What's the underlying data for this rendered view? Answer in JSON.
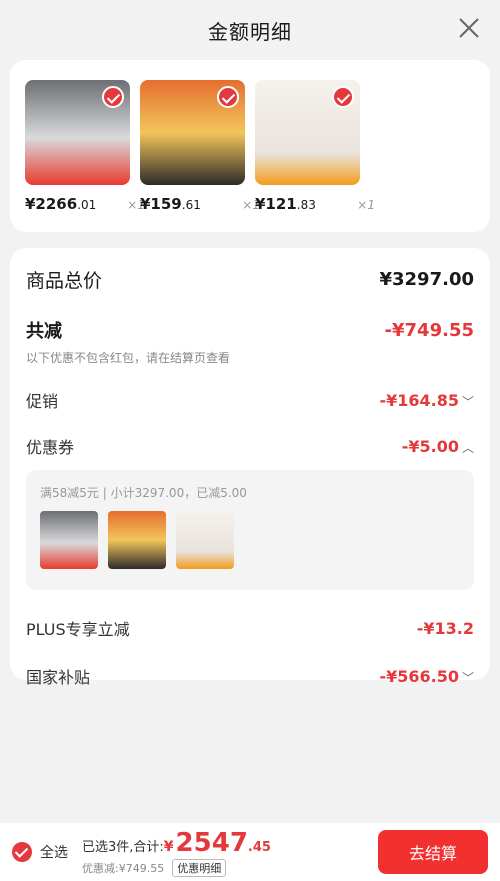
{
  "header": {
    "title": "金额明细"
  },
  "products": [
    {
      "price_int": "¥2266",
      "price_dec": ".01",
      "qty": "×1",
      "colors": [
        "#6c6f73",
        "#d9dadc",
        "#e73a2f"
      ]
    },
    {
      "price_int": "¥159",
      "price_dec": ".61",
      "qty": "×1",
      "colors": [
        "#e56e2f",
        "#f3c55a",
        "#2b2b2b"
      ]
    },
    {
      "price_int": "¥121",
      "price_dec": ".83",
      "qty": "×1",
      "colors": [
        "#f5f1ec",
        "#e9e3dc",
        "#f39b1c"
      ]
    }
  ],
  "summary": {
    "total_label": "商品总价",
    "total_value": "¥3297.00",
    "reduce_label": "共减",
    "reduce_value": "-¥749.55",
    "note": "以下优惠不包含红包，请在结算页查看",
    "promo_label": "促销",
    "promo_value": "-¥164.85",
    "coupon_label": "优惠券",
    "coupon_value": "-¥5.00",
    "coupon_detail": "满58减5元 | 小计3297.00，已减5.00",
    "plus_label": "PLUS专享立减",
    "plus_value": "-¥13.2",
    "gov_label": "国家补贴",
    "gov_value": "-¥566.50"
  },
  "footer": {
    "select_all": "全选",
    "selected": "已选3件,合计:",
    "currency": "¥",
    "amount_int": "2547",
    "amount_dec": ".45",
    "discount": "优惠减:¥749.55",
    "detail_tag": "优惠明细",
    "pay_button": "去结算"
  },
  "colors": {
    "accent": "#e4393c",
    "pay": "#f23030"
  }
}
